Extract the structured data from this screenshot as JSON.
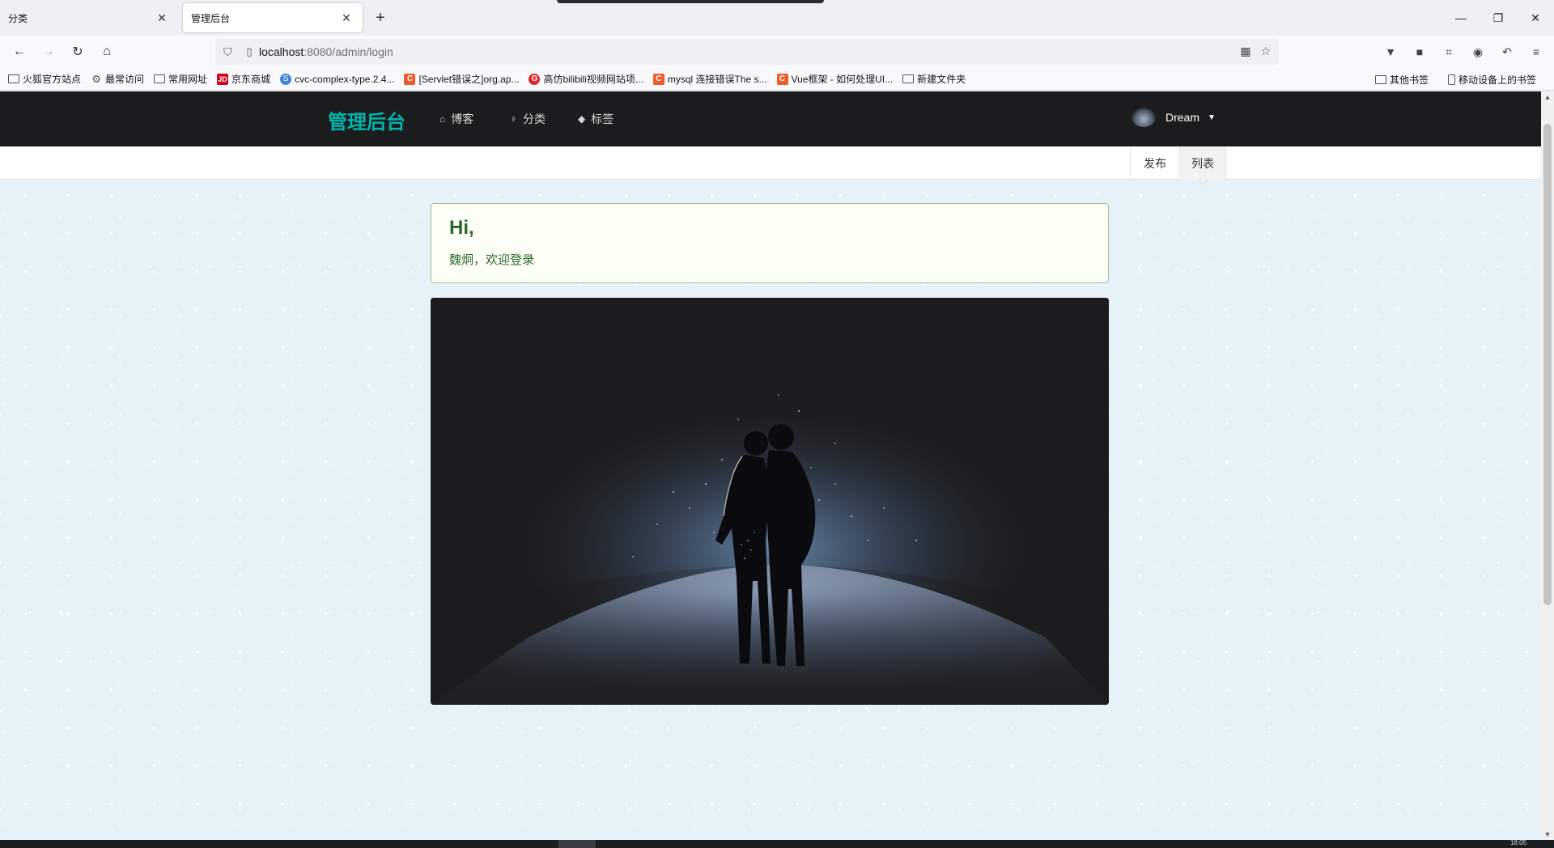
{
  "browser": {
    "tabs": [
      {
        "title": "分类",
        "active": false
      },
      {
        "title": "管理后台",
        "active": true
      }
    ],
    "new_tab_icon": "plus-icon",
    "window_controls": [
      "minimize-icon",
      "restore-icon",
      "close-icon"
    ],
    "url": {
      "host": "localhost",
      "path": ":8080/admin/login"
    },
    "bookmarks": [
      {
        "label": "火狐官方站点",
        "icon": "folder-icon"
      },
      {
        "label": "最常访问",
        "icon": "gear-icon"
      },
      {
        "label": "常用网址",
        "icon": "folder-icon"
      },
      {
        "label": "京东商城",
        "icon": "jd-icon",
        "icon_text": "JD"
      },
      {
        "label": "cvc-complex-type.2.4...",
        "icon": "globe-icon",
        "icon_text": "S"
      },
      {
        "label": "[Servlet错误之]org.ap...",
        "icon": "csdn-icon",
        "icon_text": "C"
      },
      {
        "label": "高仿bilibili视频网站项...",
        "icon": "g-icon",
        "icon_text": "G"
      },
      {
        "label": "mysql 连接错误The s...",
        "icon": "csdn-icon",
        "icon_text": "C"
      },
      {
        "label": "Vue框架 - 如何处理UI...",
        "icon": "csdn-icon",
        "icon_text": "C"
      },
      {
        "label": "新建文件夹",
        "icon": "folder-icon"
      }
    ],
    "bookmarks_right": [
      {
        "label": "其他书签",
        "icon": "folder-icon"
      },
      {
        "label": "移动设备上的书签",
        "icon": "mobile-icon"
      }
    ]
  },
  "app": {
    "brand": "管理后台",
    "menu": [
      {
        "label": "博客",
        "icon": "home-icon"
      },
      {
        "label": "分类",
        "icon": "idea-icon"
      },
      {
        "label": "标签",
        "icon": "tags-icon"
      }
    ],
    "user": {
      "name": "Dream"
    },
    "submenu": [
      {
        "label": "发布",
        "active": false
      },
      {
        "label": "列表",
        "active": true
      }
    ],
    "message": {
      "header": "Hi,",
      "body": "魏炯，欢迎登录"
    }
  },
  "taskbar": {
    "time": "18:05"
  },
  "colors": {
    "brand": "#00b5ad",
    "topmenu_bg": "#1b1c1d",
    "message_bg": "#fcfff5",
    "message_text": "#2c662d",
    "page_bg": "#e6f1f8"
  }
}
